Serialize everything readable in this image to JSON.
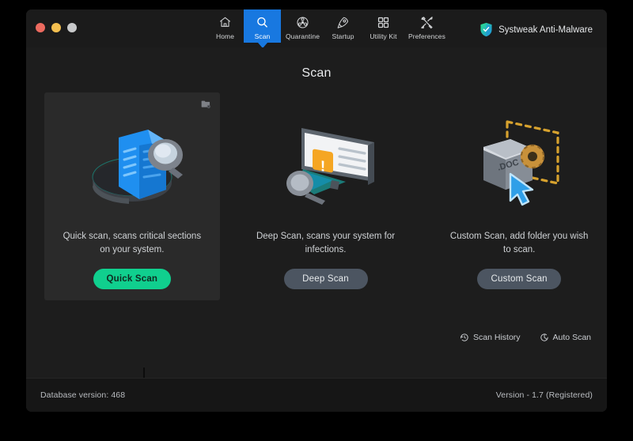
{
  "window": {
    "traffic_lights": [
      {
        "name": "close",
        "color": "#ec6a5f"
      },
      {
        "name": "minimize",
        "color": "#f4bf50"
      },
      {
        "name": "zoom",
        "color": "#c8c9ca"
      }
    ]
  },
  "nav": {
    "items": [
      {
        "label": "Home",
        "icon": "home-icon",
        "active": false
      },
      {
        "label": "Scan",
        "icon": "magnifier-icon",
        "active": true
      },
      {
        "label": "Quarantine",
        "icon": "biohazard-icon",
        "active": false
      },
      {
        "label": "Startup",
        "icon": "rocket-icon",
        "active": false
      },
      {
        "label": "Utility Kit",
        "icon": "grid-squares-icon",
        "active": false
      },
      {
        "label": "Preferences",
        "icon": "tools-icon",
        "active": false
      }
    ],
    "active_color": "#1878e0"
  },
  "brand": {
    "name": "Systweak Anti-Malware",
    "icon": "shield-check-icon",
    "color_start": "#27e08c",
    "color_end": "#1f9fe0"
  },
  "page": {
    "title": "Scan"
  },
  "cards": [
    {
      "id": "quick-scan",
      "description": "Quick scan, scans critical sections on your system.",
      "button_label": "Quick Scan",
      "button_style": "primary",
      "selected": true,
      "badge_icon": "folder-settings-icon",
      "illustration": "document-magnifier-illustration"
    },
    {
      "id": "deep-scan",
      "description": "Deep Scan, scans your system for infections.",
      "button_label": "Deep Scan",
      "button_style": "secondary",
      "selected": false,
      "illustration": "monitor-alert-magnifier-illustration"
    },
    {
      "id": "custom-scan",
      "description": "Custom Scan, add folder you wish to scan.",
      "button_label": "Custom Scan",
      "button_style": "secondary",
      "selected": false,
      "illustration": "folder-gear-cursor-illustration"
    }
  ],
  "bottom_actions": [
    {
      "label": "Scan History",
      "icon": "history-clock-icon"
    },
    {
      "label": "Auto Scan",
      "icon": "auto-scan-icon"
    }
  ],
  "footer": {
    "database_version": "Database version: 468",
    "version": "Version  -  1.7 (Registered)"
  },
  "colors": {
    "window_bg": "#1d1d1d",
    "titlebar_bg": "#1b1b1b",
    "card_selected_bg": "#2a2a2a",
    "accent_green": "#10cf8e",
    "accent_blue": "#1878e0",
    "secondary_button": "#4c5561",
    "footer_bg": "#161616"
  }
}
